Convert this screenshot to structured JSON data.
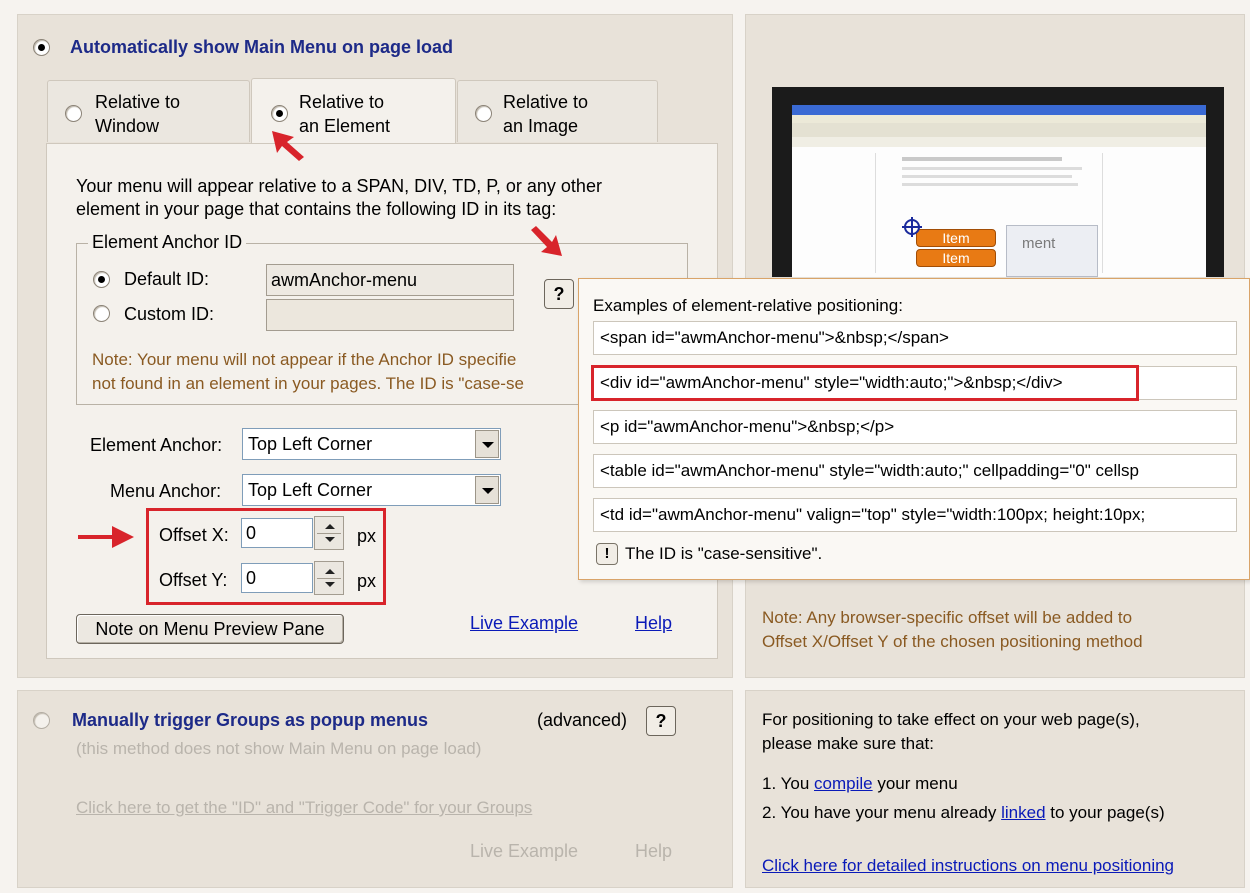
{
  "auto": {
    "title": "Automatically show Main Menu on page load",
    "tabs": [
      {
        "label": "Relative to Window",
        "line1": "Relative to",
        "line2": "Window",
        "selected": false
      },
      {
        "label": "Relative to an Element",
        "line1": "Relative to",
        "line2": "an Element",
        "selected": true
      },
      {
        "label": "Relative to an Image",
        "line1": "Relative to",
        "line2": "an Image",
        "selected": false
      }
    ],
    "description_line1": "Your menu will appear relative to a SPAN, DIV, TD, P, or any other",
    "description_line2": "element in your page that contains the following ID in its tag:",
    "anchor_group": {
      "title": "Element Anchor ID",
      "default_label": "Default ID:",
      "default_value": "awmAnchor-menu",
      "custom_label": "Custom ID:",
      "custom_value": "",
      "help": "?",
      "note_line1": "Note: Your menu will not appear if the Anchor ID specifie",
      "note_line2": "not found in an element in your pages. The ID is \"case-se"
    },
    "element_anchor_label": "Element Anchor:",
    "element_anchor_value": "Top Left Corner",
    "menu_anchor_label": "Menu Anchor:",
    "menu_anchor_value": "Top Left Corner",
    "offset_x_label": "Offset X:",
    "offset_x_value": "0",
    "offset_y_label": "Offset Y:",
    "offset_y_value": "0",
    "px": "px",
    "note_button": "Note on Menu Preview Pane",
    "live_example": "Live Example",
    "help": "Help"
  },
  "manual": {
    "title": "Manually trigger Groups as popup menus",
    "advanced": "(advanced)",
    "help_icon": "?",
    "subtitle": "(this method does not show Main Menu on page load)",
    "click_here": "Click here to get the \"ID\" and \"Trigger Code\" for your Groups",
    "live_example": "Live Example",
    "help": "Help"
  },
  "popup": {
    "title": "Examples of element-relative positioning:",
    "examples": [
      "<span id=\"awmAnchor-menu\">&nbsp;</span>",
      "<div id=\"awmAnchor-menu\" style=\"width:auto;\">&nbsp;</div>",
      "<p id=\"awmAnchor-menu\">&nbsp;</p>",
      "<table id=\"awmAnchor-menu\" style=\"width:auto;\" cellpadding=\"0\" cellsp",
      "<td id=\"awmAnchor-menu\" valign=\"top\" style=\"width:100px; height:10px;"
    ],
    "info_icon": "!",
    "case_note": "The ID is \"case-sensitive\"."
  },
  "preview": {
    "item1": "Item",
    "item2": "Item",
    "side_text": "ment",
    "note_line1": "Note: Any browser-specific offset will be added to",
    "note_line2": "Offset X/Offset Y of the chosen positioning method"
  },
  "instructions": {
    "line1": "For positioning to take effect on your web page(s),",
    "line2": "please make sure that:",
    "step1_prefix": "1. You ",
    "step1_link": "compile",
    "step1_suffix": " your menu",
    "step2_prefix": "2. You have your menu already ",
    "step2_link": "linked",
    "step2_suffix": " to your page(s)",
    "detail_link": "Click here for detailed instructions on menu positioning"
  },
  "colors": {
    "accent_red": "#d8242b",
    "title_blue": "#1d2a88",
    "link_blue": "#0a1ab8",
    "note_brown": "#8a5a22"
  }
}
